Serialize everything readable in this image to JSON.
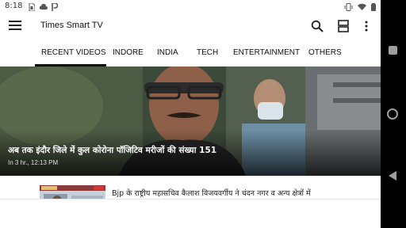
{
  "status_bar": {
    "time": "8:18",
    "icons": [
      "sim-card-icon",
      "cloud-icon",
      "parking-icon"
    ],
    "right_icons": [
      "vibrate-icon",
      "wifi-icon",
      "battery-icon"
    ]
  },
  "app_bar": {
    "title": "Times Smart TV",
    "icons": [
      "menu-icon",
      "search-icon",
      "layout-icon",
      "more-vert-icon"
    ]
  },
  "tabs": [
    {
      "label": "RECENT VIDEOS",
      "selected": true
    },
    {
      "label": "INDORE",
      "selected": false
    },
    {
      "label": "INDIA",
      "selected": false
    },
    {
      "label": "TECH",
      "selected": false
    },
    {
      "label": "ENTERTAINMENT",
      "selected": false
    },
    {
      "label": "OTHERS",
      "selected": false
    }
  ],
  "hero": {
    "headline": "अब तक इंदौर जिले में कुल कोरोना पॉजिटिव मरीजों की संख्या 151",
    "time": "In 3 hr., 12:13 PM"
  },
  "list": [
    {
      "title": "Bjp के राष्ट्रीय महासचिव कैलाश विजयवर्गीय ने चंदन नगर व अन्य क्षेत्रों में"
    }
  ],
  "colors": {
    "tab_indicator": "#111111",
    "nav_icons": "#9e9e9e",
    "background": "#ffffff"
  }
}
